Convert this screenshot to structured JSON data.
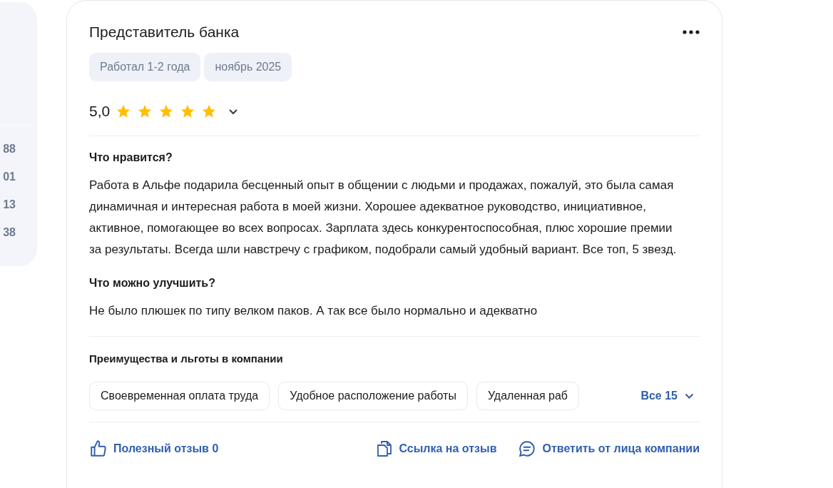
{
  "side_panel": {
    "numbers": [
      "88",
      "01",
      "13",
      "38"
    ]
  },
  "review": {
    "title": "Представитель банка",
    "tags": [
      "Работал 1-2 года",
      "ноябрь 2025"
    ],
    "rating": "5,0",
    "stars": 5,
    "sections": [
      {
        "heading": "Что нравится?",
        "text": "Работа в Альфе подарила бесценный опыт в общении с людьми и продажах, пожалуй, это была самая динамичная и интересная работа в моей жизни. Хорошее адекватное руководство, инициативное, активное, помогающее во всех вопросах. Зарплата здесь конкурентоспособная, плюс хорошие премии за результаты. Всегда шли навстречу с графиком, подобрали самый удобный вариант. Все топ, 5 звезд."
      },
      {
        "heading": "Что можно улучшить?",
        "text": "Не было плюшек по типу велком паков. А так все было нормально и адекватно"
      }
    ],
    "benefits": {
      "heading": "Преимущества и льготы в компании",
      "items": [
        "Своевременная оплата труда",
        "Удобное расположение работы",
        "Удаленная раб"
      ],
      "all": "Все 15"
    },
    "actions": [
      {
        "kind": "like",
        "label": "Полезный отзыв 0"
      },
      {
        "kind": "link",
        "label": "Ссылка на отзыв"
      },
      {
        "kind": "reply",
        "label": "Ответить от лица компании"
      }
    ]
  }
}
